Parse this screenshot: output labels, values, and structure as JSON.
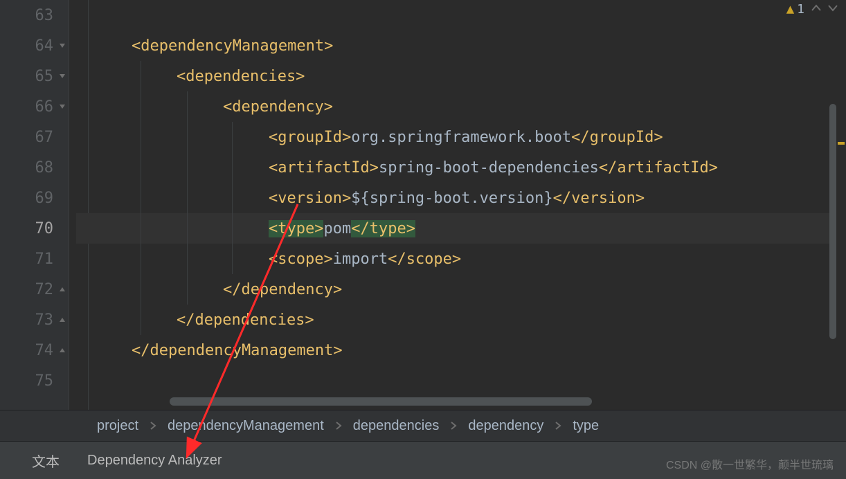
{
  "gutter": {
    "lines": [
      "63",
      "64",
      "65",
      "66",
      "67",
      "68",
      "69",
      "70",
      "71",
      "72",
      "73",
      "74",
      "75"
    ],
    "current_line": "70"
  },
  "folds": {
    "64": "open",
    "65": "open",
    "66": "open",
    "72": "close",
    "73": "close",
    "74": "close"
  },
  "warning": {
    "count": "1"
  },
  "code": {
    "l63": "",
    "l64": {
      "open": "<dependencyManagement>",
      "indent": 1
    },
    "l65": {
      "open": "<dependencies>",
      "indent": 2
    },
    "l66": {
      "open": "<dependency>",
      "indent": 3
    },
    "l67": {
      "open": "<groupId>",
      "text": "org.springframework.boot",
      "close": "</groupId>",
      "indent": 4
    },
    "l68": {
      "open": "<artifactId>",
      "text": "spring-boot-dependencies",
      "close": "</artifactId>",
      "indent": 4
    },
    "l69": {
      "open": "<version>",
      "text": "${spring-boot.version}",
      "close": "</version>",
      "indent": 4
    },
    "l70": {
      "open": "<type>",
      "text": "pom",
      "close": "</type>",
      "indent": 4
    },
    "l71": {
      "open": "<scope>",
      "text": "import",
      "close": "</scope>",
      "indent": 4
    },
    "l72": {
      "open": "</dependency>",
      "indent": 3
    },
    "l73": {
      "open": "</dependencies>",
      "indent": 2
    },
    "l74": {
      "open": "</dependencyManagement>",
      "indent": 1
    },
    "l75": ""
  },
  "breadcrumb": {
    "items": [
      "project",
      "dependencyManagement",
      "dependencies",
      "dependency",
      "type"
    ]
  },
  "bottom_tabs": {
    "tab1": "文本",
    "tab2": "Dependency Analyzer"
  },
  "watermark": "CSDN @散一世繁华，颠半世琉璃"
}
